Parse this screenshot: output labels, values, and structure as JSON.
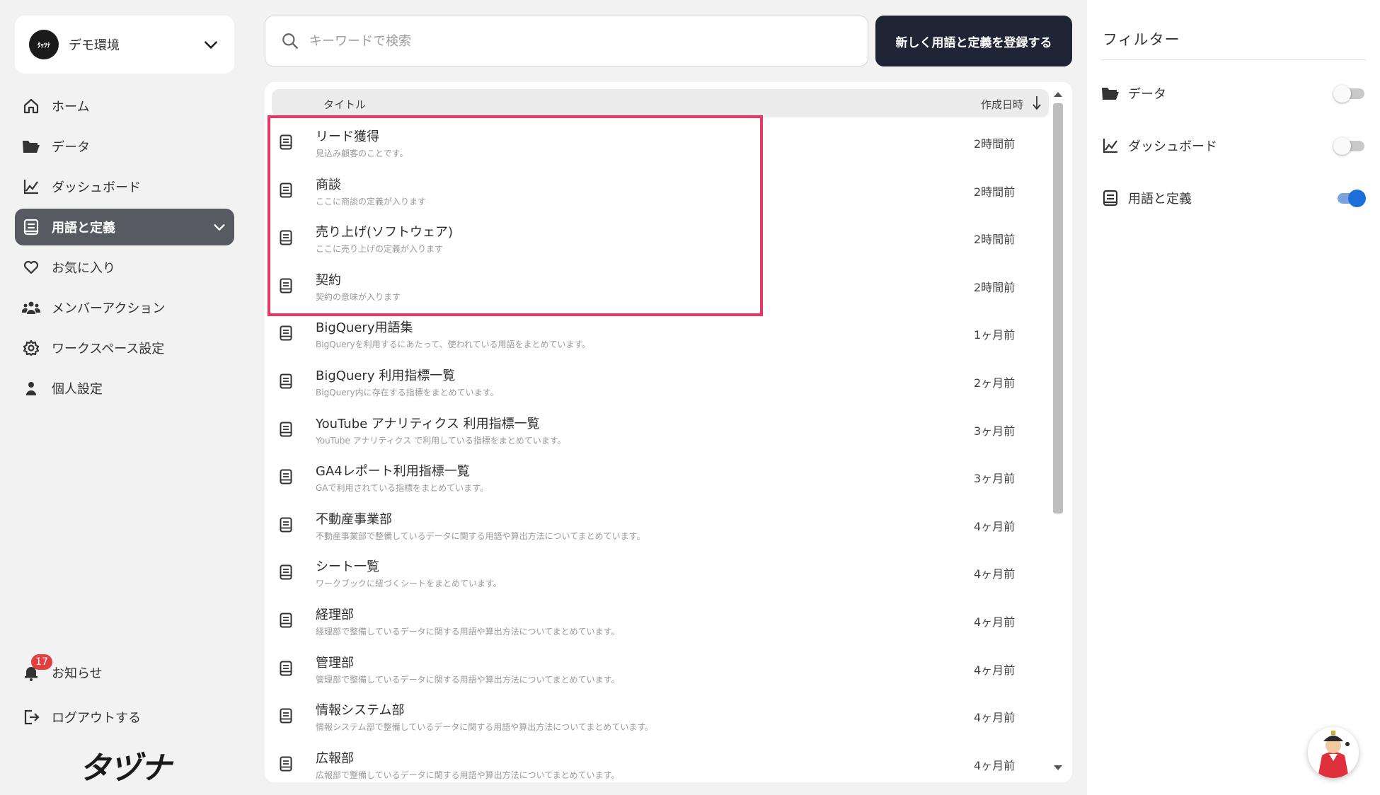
{
  "workspace": {
    "logo_text": "ﾀｯﾂﾅ",
    "name": "デモ環境"
  },
  "nav": {
    "items": [
      {
        "id": "home",
        "label": "ホーム",
        "icon": "home-icon"
      },
      {
        "id": "data",
        "label": "データ",
        "icon": "folder-icon"
      },
      {
        "id": "dashboard",
        "label": "ダッシュボード",
        "icon": "chart-line-icon"
      },
      {
        "id": "glossary",
        "label": "用語と定義",
        "icon": "book-icon",
        "active": true
      },
      {
        "id": "favorites",
        "label": "お気に入り",
        "icon": "heart-icon"
      },
      {
        "id": "member-actions",
        "label": "メンバーアクション",
        "icon": "people-icon"
      },
      {
        "id": "workspace-settings",
        "label": "ワークスペース設定",
        "icon": "gear-icon"
      },
      {
        "id": "personal-settings",
        "label": "個人設定",
        "icon": "person-icon"
      }
    ],
    "notifications_label": "お知らせ",
    "notifications_count": "17",
    "logout_label": "ログアウトする",
    "brand": "タヅナ"
  },
  "search": {
    "placeholder": "キーワードで検索",
    "value": ""
  },
  "register_button": "新しく用語と定義を登録する",
  "list": {
    "header_title": "タイトル",
    "header_date": "作成日時",
    "rows": [
      {
        "title": "リード獲得",
        "desc": "見込み顧客のことです。",
        "date": "2時間前"
      },
      {
        "title": "商談",
        "desc": "ここに商談の定義が入ります",
        "date": "2時間前"
      },
      {
        "title": "売り上げ(ソフトウェア)",
        "desc": "ここに売り上げの定義が入ります",
        "date": "2時間前"
      },
      {
        "title": "契約",
        "desc": "契約の意味が入ります",
        "date": "2時間前"
      },
      {
        "title": "BigQuery用語集",
        "desc": "BigQueryを利用するにあたって、使われている用語をまとめています。",
        "date": "1ヶ月前"
      },
      {
        "title": "BigQuery 利用指標一覧",
        "desc": "BigQuery内に存在する指標をまとめています。",
        "date": "2ヶ月前"
      },
      {
        "title": "YouTube アナリティクス 利用指標一覧",
        "desc": "YouTube アナリティクス で利用している指標をまとめています。",
        "date": "3ヶ月前"
      },
      {
        "title": "GA4レポート利用指標一覧",
        "desc": "GAで利用されている指標をまとめています。",
        "date": "3ヶ月前"
      },
      {
        "title": "不動産事業部",
        "desc": "不動産事業部で整備しているデータに関する用語や算出方法についてまとめています。",
        "date": "4ヶ月前"
      },
      {
        "title": "シート一覧",
        "desc": "ワークブックに紐づくシートをまとめています。",
        "date": "4ヶ月前"
      },
      {
        "title": "経理部",
        "desc": "経理部で整備しているデータに関する用語や算出方法についてまとめています。",
        "date": "4ヶ月前"
      },
      {
        "title": "管理部",
        "desc": "管理部で整備しているデータに関する用語や算出方法についてまとめています。",
        "date": "4ヶ月前"
      },
      {
        "title": "情報システム部",
        "desc": "情報システム部で整備しているデータに関する用語や算出方法についてまとめています。",
        "date": "4ヶ月前"
      },
      {
        "title": "広報部",
        "desc": "広報部で整備しているデータに関する用語や算出方法についてまとめています。",
        "date": "4ヶ月前"
      }
    ]
  },
  "filter": {
    "title": "フィルター",
    "items": [
      {
        "label": "データ",
        "icon": "folder-icon",
        "on": false
      },
      {
        "label": "ダッシュボード",
        "icon": "chart-line-icon",
        "on": false
      },
      {
        "label": "用語と定義",
        "icon": "book-icon",
        "on": true
      }
    ]
  },
  "colors": {
    "accent": "#1c6fd8",
    "highlight": "#ea3565",
    "button_bg": "#1f2535",
    "nav_active_bg": "#575a61",
    "badge": "#e24040"
  }
}
